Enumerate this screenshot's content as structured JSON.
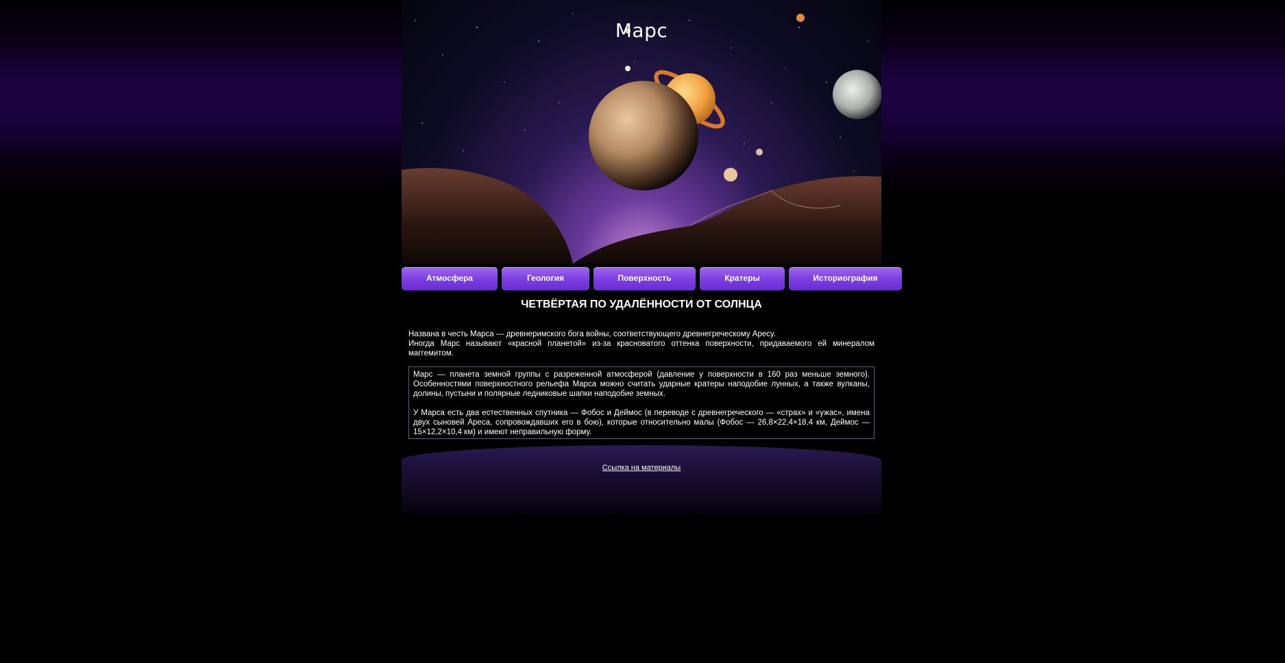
{
  "header": {
    "title": "Марс"
  },
  "nav": [
    {
      "label": "Атмосфера"
    },
    {
      "label": "Геология"
    },
    {
      "label": "Поверхность"
    },
    {
      "label": "Кратеры"
    },
    {
      "label": "Историография"
    }
  ],
  "main": {
    "heading": "ЧЕТВЁРТАЯ ПО УДАЛЁННОСТИ ОТ СОЛНЦА",
    "intro_line1": "Названа в честь Марса — древнеримского бога войны, соответствующего древнегреческому Аресу.",
    "intro_line2": "Иногда Марс называют «красной планетой» из-за красноватого оттенка поверхности, придаваемого ей минералом маггемитом.",
    "box_paragraph1": "Марс — планета земной группы с разреженной атмосферой (давление у поверхности в 160 раз меньше земного). Особенностями поверхностного рельефа Марса можно считать ударные кратеры наподобие лунных, а также вулканы, долины, пустыни и полярные ледниковые шапки наподобие земных.",
    "box_paragraph2": "У Марса есть два естественных спутника — Фобос и Деймос (в переводе с древнегреческого — «страх» и «ужас», имена двух сыновей Ареса, сопровождавших его в бою), которые относительно малы (Фобос — 26,8×22,4×18,4 км, Деймос — 15×12,2×10,4 км) и имеют неправильную форму."
  },
  "footer": {
    "link_label": "Ссылка на материалы"
  },
  "colors": {
    "nav_button": "#7a3de0",
    "background_glow": "#1c0442"
  }
}
